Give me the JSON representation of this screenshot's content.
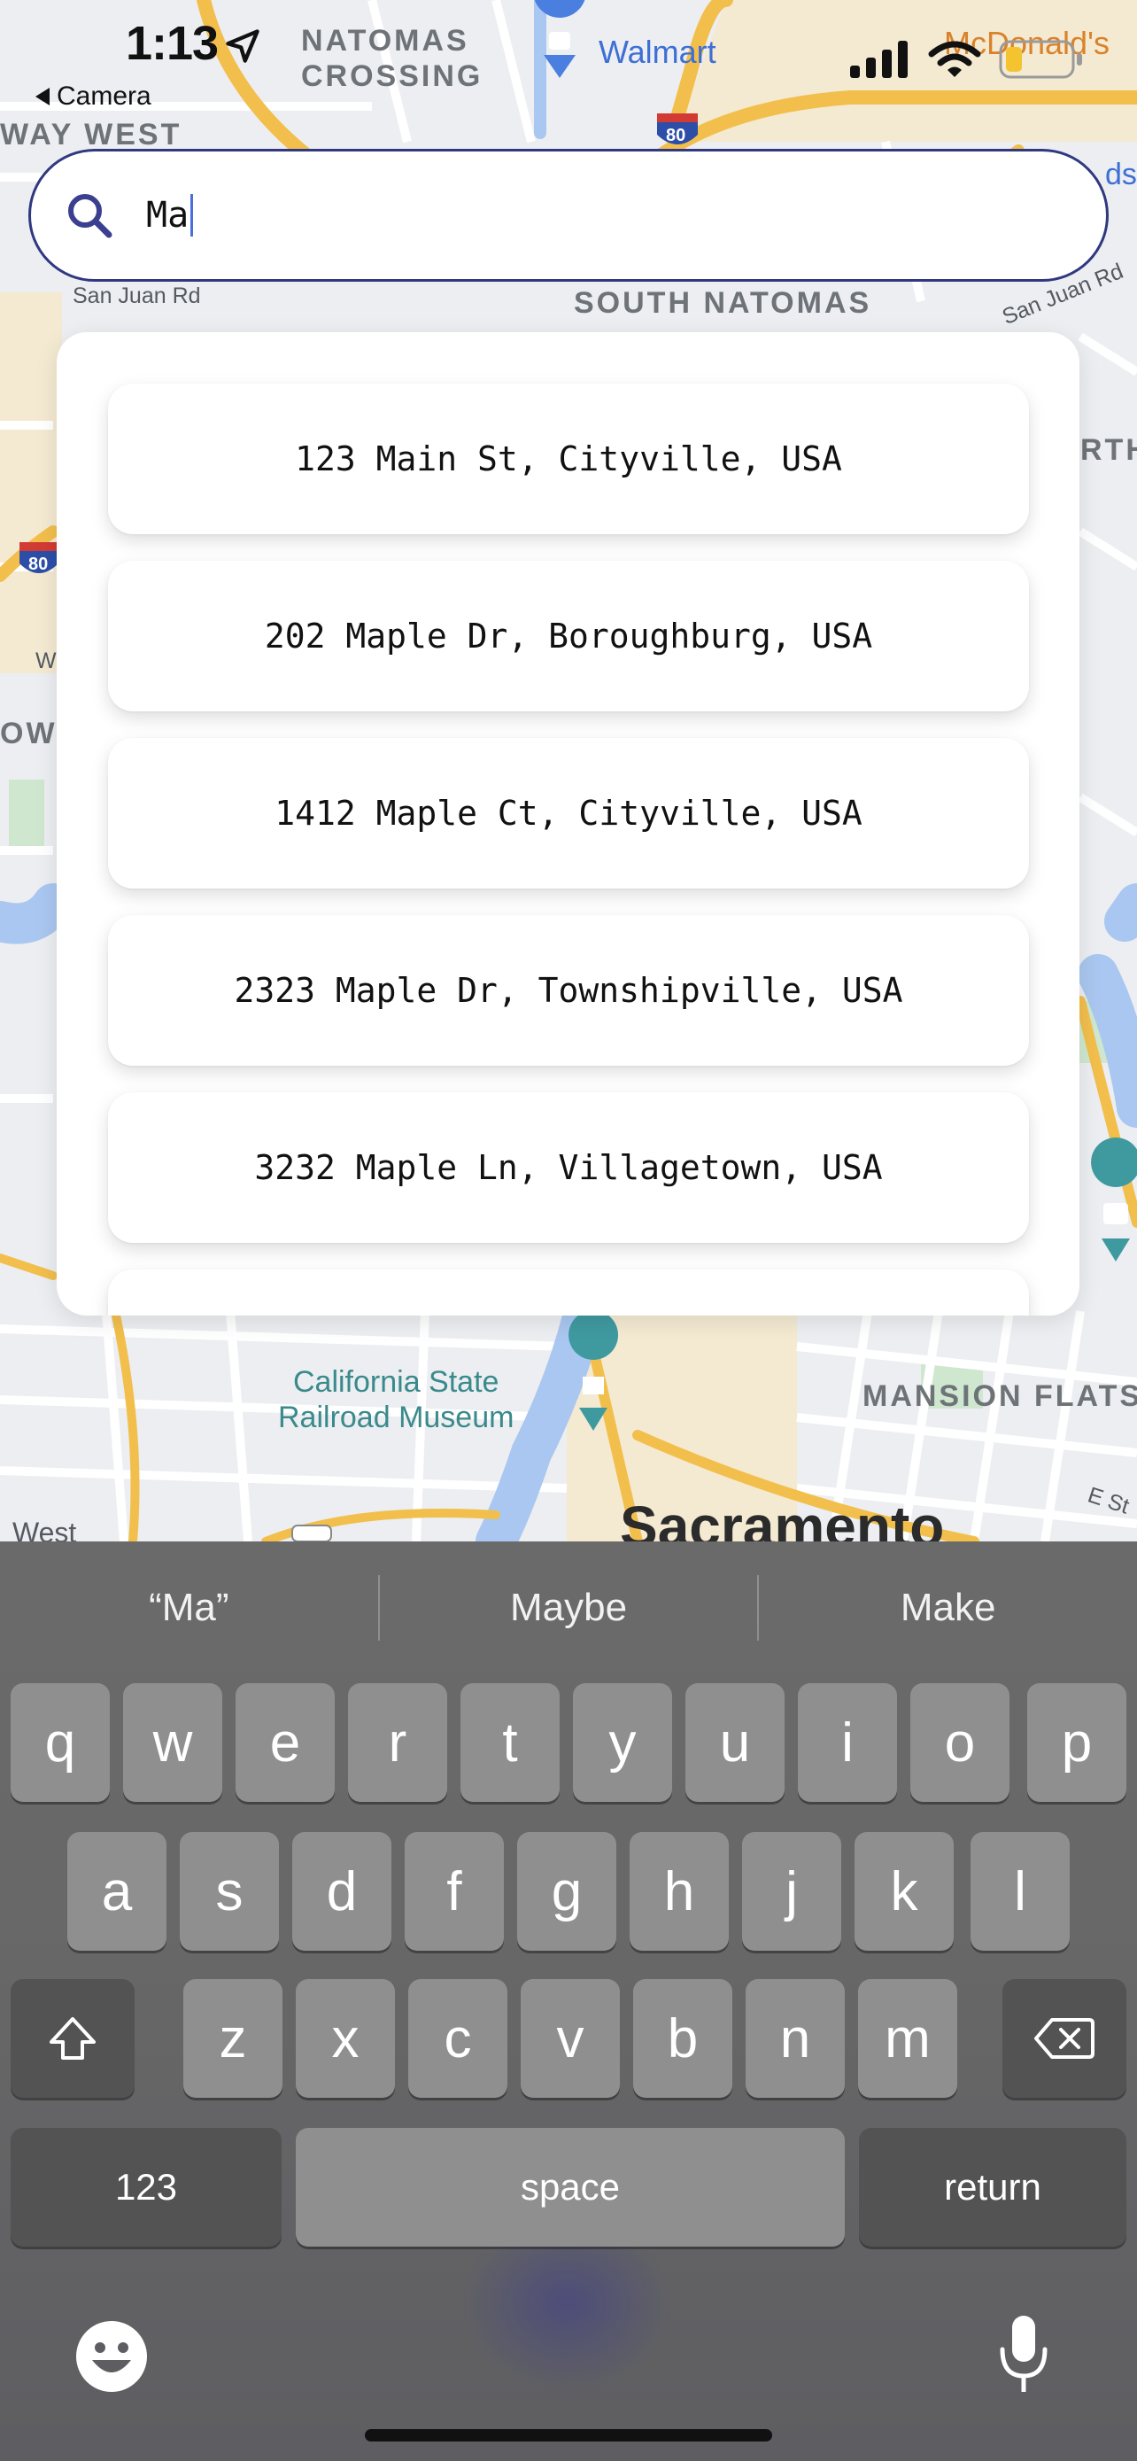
{
  "status_bar": {
    "time": "1:13",
    "back_label": "Camera",
    "icons": [
      "location-arrow-icon",
      "signal-icon",
      "wifi-icon",
      "battery-icon"
    ]
  },
  "map": {
    "labels": {
      "natomas_line1": "NATOMAS",
      "natomas_line2": "CROSSING",
      "walmart": "Walmart",
      "mcdonalds": "McDonald's",
      "way_west": "WAY WEST",
      "san_juan_rd_left": "San Juan Rd",
      "south_natomas": "SOUTH NATOMAS",
      "san_juan_rd_right": "San Juan Rd",
      "rth": "RTH",
      "highway_80_top": "80",
      "highway_80_left": "80",
      "w": "W",
      "ow": "OW",
      "museum_line1": "California State",
      "museum_line2": "Railroad Museum",
      "mansion_flats": "MANSION FLATS",
      "e_st": "E St",
      "sacramento": "Sacramento",
      "west": "West",
      "ds": "ds"
    }
  },
  "search": {
    "value": "Ma"
  },
  "suggestions": [
    "123 Main St, Cityville, USA",
    "202 Maple Dr, Boroughburg, USA",
    "1412 Maple Ct, Cityville, USA",
    "2323 Maple Dr, Townshipville, USA",
    "3232 Maple Ln, Villagetown, USA"
  ],
  "keyboard": {
    "predictions": [
      "“Ma”",
      "Maybe",
      "Make"
    ],
    "row1": [
      "q",
      "w",
      "e",
      "r",
      "t",
      "y",
      "u",
      "i",
      "o",
      "p"
    ],
    "row2": [
      "a",
      "s",
      "d",
      "f",
      "g",
      "h",
      "j",
      "k",
      "l"
    ],
    "row3": [
      "z",
      "x",
      "c",
      "v",
      "b",
      "n",
      "m"
    ],
    "numbers_label": "123",
    "space_label": "space",
    "return_label": "return"
  },
  "colors": {
    "search_border": "#303880",
    "search_icon": "#3b3f8f",
    "keyboard_bg": "#686868",
    "key_bg": "#8f8f8f",
    "key_dark_bg": "#535353"
  }
}
